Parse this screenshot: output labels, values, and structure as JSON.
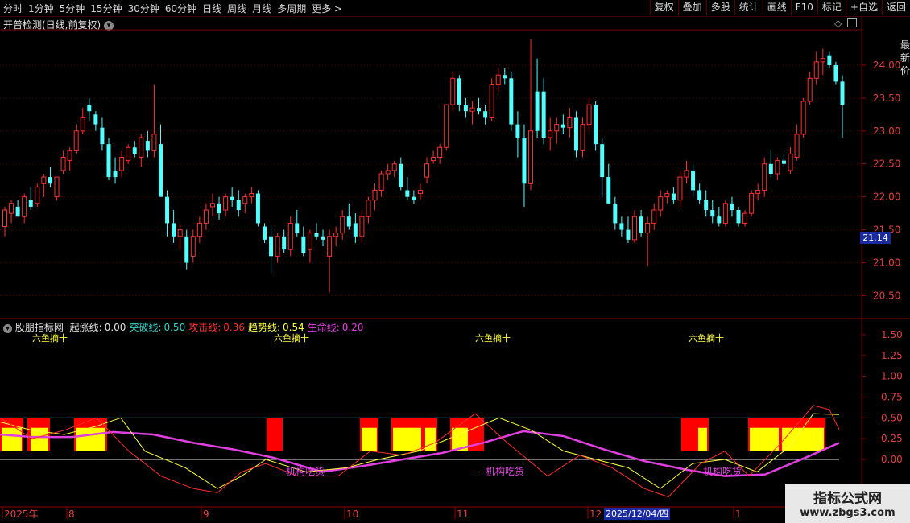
{
  "toolbar": {
    "periods": [
      "分时",
      "1分钟",
      "5分钟",
      "15分钟",
      "30分钟",
      "60分钟",
      "日线",
      "周线",
      "月线",
      "多周期",
      "更多 >"
    ],
    "tools": [
      "复权",
      "叠加",
      "多股",
      "统计",
      "画线",
      "F10",
      "标记",
      "+自选",
      "返回"
    ]
  },
  "main_chart": {
    "title": "开普检测(日线,前复权)",
    "price_ticks": [
      "24.00",
      "23.50",
      "23.00",
      "22.50",
      "22.00",
      "21.50",
      "21.00",
      "20.50"
    ],
    "current_price": "21.14",
    "side_text": "最新价"
  },
  "indicator": {
    "name": "股朋指标网",
    "lines": [
      {
        "label": "起涨线:",
        "value": "0.00",
        "color": "#e0e0e0"
      },
      {
        "label": "突破线:",
        "value": "0.50",
        "color": "#36d0c8"
      },
      {
        "label": "攻击线:",
        "value": "0.36",
        "color": "#ff3030"
      },
      {
        "label": "趋势线:",
        "value": "0.54",
        "color": "#ffff40"
      },
      {
        "label": "生命线:",
        "value": "0.20",
        "color": "#e040e0"
      }
    ],
    "ticks": [
      "1.50",
      "1.25",
      "1.00",
      "0.75",
      "0.50",
      "0.25",
      "0.00"
    ],
    "signal_top": "六鱼摘十",
    "signal_bottom": "机构吃货"
  },
  "date_axis": {
    "labels": [
      "2025年",
      "8",
      "9",
      "10",
      "11",
      "12",
      "1"
    ],
    "cursor_date": "2025/12/04/四"
  },
  "watermark": {
    "title": "指标公式网",
    "url": "www.zbgs3.com"
  },
  "chart_data": {
    "type": "candlestick",
    "title": "开普检测(日线,前复权)",
    "ylim": [
      20.2,
      24.5
    ],
    "candles": [
      [
        21.55,
        21.85,
        21.4,
        21.8,
        "up"
      ],
      [
        21.75,
        21.95,
        21.6,
        21.9,
        "up"
      ],
      [
        21.85,
        21.95,
        21.7,
        21.7,
        "down"
      ],
      [
        21.7,
        22.05,
        21.6,
        22.0,
        "up"
      ],
      [
        21.95,
        22.15,
        21.8,
        21.85,
        "down"
      ],
      [
        21.9,
        22.2,
        21.85,
        22.15,
        "up"
      ],
      [
        22.2,
        22.35,
        22.0,
        22.3,
        "up"
      ],
      [
        22.3,
        22.45,
        22.15,
        22.2,
        "down"
      ],
      [
        22.0,
        22.3,
        21.95,
        22.3,
        "up"
      ],
      [
        22.4,
        22.7,
        22.35,
        22.6,
        "up"
      ],
      [
        22.55,
        22.75,
        22.4,
        22.7,
        "up"
      ],
      [
        22.7,
        23.1,
        22.65,
        23.0,
        "up"
      ],
      [
        23.0,
        23.35,
        22.95,
        23.2,
        "up"
      ],
      [
        23.3,
        23.5,
        23.15,
        23.4,
        "down"
      ],
      [
        23.25,
        23.3,
        23.0,
        23.1,
        "down"
      ],
      [
        23.05,
        23.2,
        22.7,
        22.8,
        "down"
      ],
      [
        22.8,
        22.9,
        22.25,
        22.3,
        "down"
      ],
      [
        22.4,
        22.6,
        22.2,
        22.3,
        "down"
      ],
      [
        22.4,
        22.7,
        22.3,
        22.6,
        "up"
      ],
      [
        22.55,
        22.8,
        22.5,
        22.75,
        "up"
      ],
      [
        22.75,
        22.85,
        22.6,
        22.65,
        "down"
      ],
      [
        22.6,
        22.95,
        22.45,
        22.9,
        "up"
      ],
      [
        22.85,
        23.0,
        22.6,
        22.7,
        "down"
      ],
      [
        22.7,
        23.7,
        22.6,
        22.95,
        "up"
      ],
      [
        22.8,
        23.1,
        22.0,
        22.0,
        "down"
      ],
      [
        22.0,
        22.1,
        21.4,
        21.6,
        "down"
      ],
      [
        21.6,
        21.8,
        21.3,
        21.4,
        "down"
      ],
      [
        21.4,
        21.6,
        21.2,
        21.5,
        "up"
      ],
      [
        21.4,
        21.5,
        20.9,
        21.0,
        "down"
      ],
      [
        21.1,
        21.5,
        21.0,
        21.4,
        "up"
      ],
      [
        21.4,
        21.7,
        21.3,
        21.6,
        "up"
      ],
      [
        21.6,
        21.9,
        21.5,
        21.8,
        "up"
      ],
      [
        21.85,
        22.05,
        21.7,
        21.9,
        "up"
      ],
      [
        21.9,
        22.0,
        21.65,
        21.75,
        "down"
      ],
      [
        21.8,
        22.05,
        21.7,
        22.0,
        "up"
      ],
      [
        22.0,
        22.15,
        21.85,
        21.95,
        "down"
      ],
      [
        21.95,
        22.1,
        21.7,
        21.8,
        "down"
      ],
      [
        21.9,
        22.05,
        21.75,
        22.0,
        "up"
      ],
      [
        22.0,
        22.15,
        21.9,
        22.05,
        "up"
      ],
      [
        22.05,
        22.1,
        21.55,
        21.6,
        "down"
      ],
      [
        21.55,
        21.6,
        21.3,
        21.35,
        "down"
      ],
      [
        21.4,
        21.55,
        20.85,
        21.1,
        "down"
      ],
      [
        21.1,
        21.45,
        21.0,
        21.4,
        "up"
      ],
      [
        21.4,
        21.5,
        21.15,
        21.2,
        "down"
      ],
      [
        21.2,
        21.7,
        21.1,
        21.6,
        "up"
      ],
      [
        21.6,
        21.8,
        21.4,
        21.45,
        "down"
      ],
      [
        21.4,
        21.55,
        21.1,
        21.15,
        "down"
      ],
      [
        21.2,
        21.5,
        21.0,
        21.45,
        "up"
      ],
      [
        21.45,
        21.6,
        21.35,
        21.4,
        "down"
      ],
      [
        21.4,
        21.5,
        21.25,
        21.35,
        "down"
      ],
      [
        21.1,
        21.5,
        20.55,
        21.4,
        "up"
      ],
      [
        21.4,
        21.55,
        21.25,
        21.45,
        "up"
      ],
      [
        21.45,
        21.8,
        21.35,
        21.7,
        "up"
      ],
      [
        21.7,
        21.9,
        21.5,
        21.55,
        "down"
      ],
      [
        21.6,
        21.75,
        21.3,
        21.4,
        "down"
      ],
      [
        21.4,
        21.8,
        21.3,
        21.7,
        "up"
      ],
      [
        21.7,
        22.0,
        21.6,
        21.95,
        "up"
      ],
      [
        21.95,
        22.2,
        21.8,
        22.1,
        "up"
      ],
      [
        22.1,
        22.4,
        22.0,
        22.35,
        "up"
      ],
      [
        22.35,
        22.5,
        22.25,
        22.4,
        "up"
      ],
      [
        22.4,
        22.55,
        22.3,
        22.5,
        "up"
      ],
      [
        22.5,
        22.6,
        22.1,
        22.15,
        "down"
      ],
      [
        22.1,
        22.3,
        21.95,
        22.0,
        "down"
      ],
      [
        22.0,
        22.1,
        21.9,
        21.95,
        "down"
      ],
      [
        22.05,
        22.2,
        21.95,
        22.1,
        "up"
      ],
      [
        22.3,
        22.6,
        22.2,
        22.5,
        "up"
      ],
      [
        22.55,
        22.7,
        22.5,
        22.6,
        "up"
      ],
      [
        22.6,
        22.8,
        22.5,
        22.75,
        "up"
      ],
      [
        22.75,
        23.4,
        22.7,
        23.4,
        "up"
      ],
      [
        23.4,
        23.9,
        23.3,
        23.8,
        "up"
      ],
      [
        23.8,
        23.85,
        23.3,
        23.4,
        "down"
      ],
      [
        23.4,
        23.5,
        23.2,
        23.3,
        "down"
      ],
      [
        23.3,
        23.45,
        23.1,
        23.35,
        "up"
      ],
      [
        23.35,
        23.5,
        23.25,
        23.3,
        "down"
      ],
      [
        23.3,
        23.4,
        23.1,
        23.2,
        "down"
      ],
      [
        23.2,
        23.8,
        23.15,
        23.7,
        "up"
      ],
      [
        23.7,
        23.95,
        23.6,
        23.85,
        "up"
      ],
      [
        23.85,
        23.95,
        23.7,
        23.8,
        "down"
      ],
      [
        23.8,
        23.9,
        23.0,
        23.1,
        "down"
      ],
      [
        23.1,
        23.3,
        22.6,
        22.9,
        "down"
      ],
      [
        22.9,
        23.1,
        21.85,
        22.2,
        "down"
      ],
      [
        22.2,
        24.4,
        22.1,
        23.0,
        "up"
      ],
      [
        23.0,
        24.1,
        22.9,
        23.6,
        "down"
      ],
      [
        23.6,
        23.8,
        22.8,
        22.9,
        "down"
      ],
      [
        22.9,
        23.2,
        22.7,
        23.0,
        "up"
      ],
      [
        23.0,
        23.2,
        22.8,
        23.1,
        "up"
      ],
      [
        23.1,
        23.25,
        22.95,
        23.05,
        "down"
      ],
      [
        23.05,
        23.35,
        22.9,
        23.2,
        "up"
      ],
      [
        23.2,
        23.3,
        22.6,
        22.7,
        "down"
      ],
      [
        22.7,
        23.2,
        22.6,
        23.1,
        "up"
      ],
      [
        23.1,
        23.5,
        23.0,
        23.4,
        "up"
      ],
      [
        23.4,
        23.45,
        22.7,
        22.8,
        "down"
      ],
      [
        22.8,
        22.9,
        22.0,
        22.3,
        "down"
      ],
      [
        22.3,
        22.5,
        21.9,
        21.9,
        "down"
      ],
      [
        21.9,
        22.0,
        21.5,
        21.6,
        "down"
      ],
      [
        21.6,
        21.7,
        21.4,
        21.5,
        "down"
      ],
      [
        21.5,
        21.7,
        21.3,
        21.35,
        "down"
      ],
      [
        21.35,
        21.8,
        21.3,
        21.7,
        "up"
      ],
      [
        21.7,
        21.8,
        21.4,
        21.45,
        "down"
      ],
      [
        21.45,
        21.7,
        20.95,
        21.6,
        "up"
      ],
      [
        21.6,
        21.9,
        21.5,
        21.8,
        "up"
      ],
      [
        21.8,
        22.1,
        21.7,
        22.0,
        "up"
      ],
      [
        22.0,
        22.1,
        21.9,
        22.05,
        "up"
      ],
      [
        22.05,
        22.15,
        21.9,
        21.95,
        "down"
      ],
      [
        21.95,
        22.4,
        21.85,
        22.3,
        "up"
      ],
      [
        22.3,
        22.55,
        22.2,
        22.4,
        "up"
      ],
      [
        22.4,
        22.5,
        22.0,
        22.1,
        "down"
      ],
      [
        22.1,
        22.2,
        21.9,
        21.95,
        "down"
      ],
      [
        21.95,
        22.1,
        21.7,
        21.8,
        "down"
      ],
      [
        21.8,
        21.95,
        21.6,
        21.7,
        "down"
      ],
      [
        21.7,
        21.85,
        21.55,
        21.6,
        "down"
      ],
      [
        21.6,
        21.95,
        21.55,
        21.9,
        "up"
      ],
      [
        21.9,
        22.0,
        21.7,
        21.8,
        "down"
      ],
      [
        21.8,
        21.85,
        21.55,
        21.6,
        "down"
      ],
      [
        21.6,
        21.8,
        21.55,
        21.75,
        "up"
      ],
      [
        21.75,
        22.1,
        21.7,
        22.05,
        "up"
      ],
      [
        22.05,
        22.2,
        21.95,
        22.1,
        "up"
      ],
      [
        22.1,
        22.6,
        22.0,
        22.5,
        "up"
      ],
      [
        22.5,
        22.7,
        22.3,
        22.35,
        "down"
      ],
      [
        22.35,
        22.6,
        22.25,
        22.55,
        "up"
      ],
      [
        22.55,
        22.65,
        22.45,
        22.5,
        "down"
      ],
      [
        22.4,
        22.75,
        22.35,
        22.65,
        "up"
      ],
      [
        22.6,
        23.1,
        22.55,
        22.95,
        "up"
      ],
      [
        22.95,
        23.5,
        22.9,
        23.45,
        "up"
      ],
      [
        23.45,
        23.9,
        23.4,
        23.8,
        "up"
      ],
      [
        23.8,
        24.2,
        23.7,
        24.05,
        "up"
      ],
      [
        24.05,
        24.25,
        23.85,
        24.1,
        "up"
      ],
      [
        24.15,
        24.2,
        23.95,
        24.0,
        "down"
      ],
      [
        24.0,
        24.05,
        23.7,
        23.75,
        "down"
      ],
      [
        23.75,
        23.85,
        22.9,
        23.4,
        "down"
      ]
    ]
  }
}
